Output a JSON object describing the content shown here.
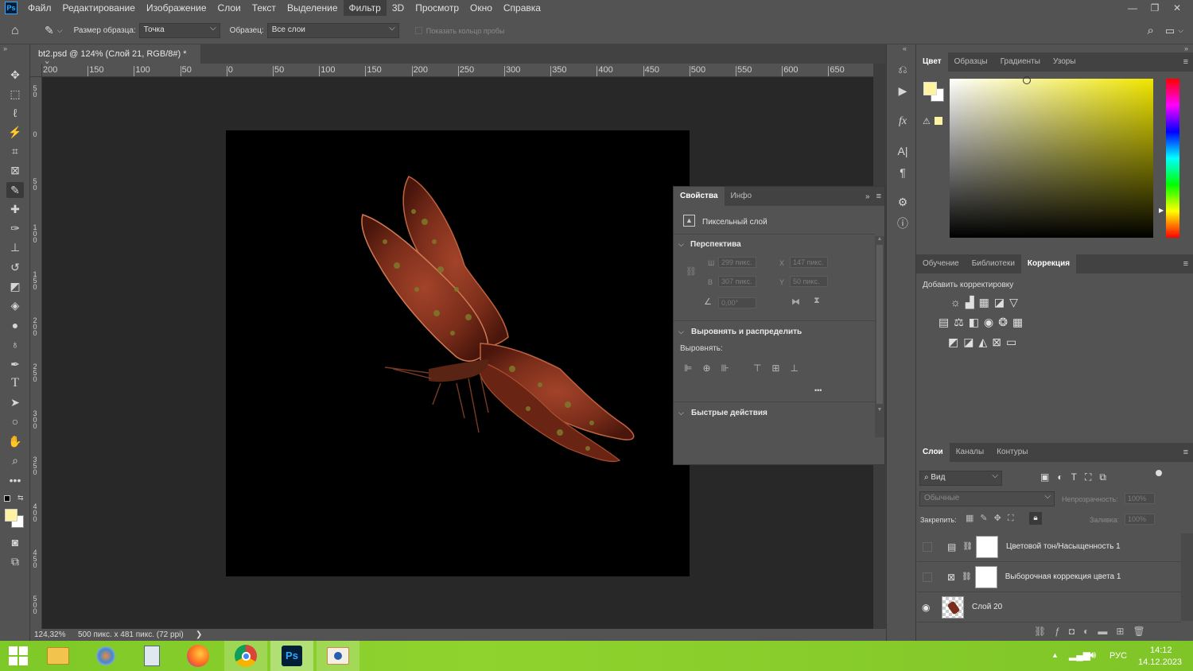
{
  "menubar": {
    "logo": "Ps",
    "items": [
      "Файл",
      "Редактирование",
      "Изображение",
      "Слои",
      "Текст",
      "Выделение",
      "Фильтр",
      "3D",
      "Просмотр",
      "Окно",
      "Справка"
    ],
    "active_index": 6,
    "window_controls": [
      "—",
      "❐",
      "✕"
    ]
  },
  "options": {
    "sample_size_label": "Размер образца:",
    "sample_size_value": "Точка",
    "sample_label": "Образец:",
    "sample_value": "Все слои",
    "show_ring_label": "Показать кольцо пробы"
  },
  "document": {
    "tab_title": "bt2.psd @ 124% (Слой 21, RGB/8#) *",
    "close": "×"
  },
  "ruler": {
    "h_labels": [
      "200",
      "150",
      "100",
      "50",
      "0",
      "50",
      "100",
      "150",
      "200",
      "250",
      "300",
      "350",
      "400",
      "450",
      "500",
      "550",
      "600",
      "650"
    ],
    "v_labels": [
      "5 0",
      "0",
      "5 0",
      "1 0 0",
      "1 5 0",
      "2 0 0",
      "2 5 0",
      "3 0 0",
      "3 5 0",
      "4 0 0",
      "4 5 0",
      "5 0 0"
    ]
  },
  "status": {
    "zoom": "124,32%",
    "size": "500 пикс. x 481 пикс. (72 ppi)",
    "arrow": "❯"
  },
  "color_panel": {
    "tabs": [
      "Цвет",
      "Образцы",
      "Градиенты",
      "Узоры"
    ],
    "active": 0,
    "foreground": "#fff2a0",
    "hue_color": "#f0e600"
  },
  "learn_panel": {
    "tabs": [
      "Обучение",
      "Библиотеки",
      "Коррекция"
    ],
    "active": 2,
    "add_label": "Добавить корректировку"
  },
  "properties": {
    "tabs": [
      "Свойства",
      "Инфо"
    ],
    "active": 0,
    "layer_type": "Пиксельный слой",
    "section_perspective": "Перспектива",
    "w_label": "Ш",
    "w_value": "299 пикс.",
    "h_label": "В",
    "h_value": "307 пикс.",
    "x_label": "X",
    "x_value": "147 пикс.",
    "y_label": "Y",
    "y_value": "50 пикс.",
    "angle_value": "0,00°",
    "section_align": "Выровнять и распределить",
    "align_label": "Выровнять:",
    "more": "•••",
    "section_quick": "Быстрые действия"
  },
  "layers_panel": {
    "tabs": [
      "Слои",
      "Каналы",
      "Контуры"
    ],
    "active": 0,
    "filter_value": "Вид",
    "blend_value": "Обычные",
    "opacity_label": "Непрозрачность:",
    "opacity_value": "100%",
    "lock_label": "Закрепить:",
    "fill_label": "Заливка:",
    "fill_value": "100%",
    "layers": [
      {
        "name": "Цветовой тон/Насыщенность 1",
        "visible": false
      },
      {
        "name": "Выборочная коррекция цвета 1",
        "visible": false
      },
      {
        "name": "Слой 20",
        "visible": true
      }
    ]
  },
  "taskbar": {
    "lang": "РУС",
    "time": "14:12",
    "date": "14.12.2023",
    "ps_label": "Ps"
  },
  "colors": {
    "accent": "#31a8ff",
    "taskbar": "#8ccf2c"
  }
}
